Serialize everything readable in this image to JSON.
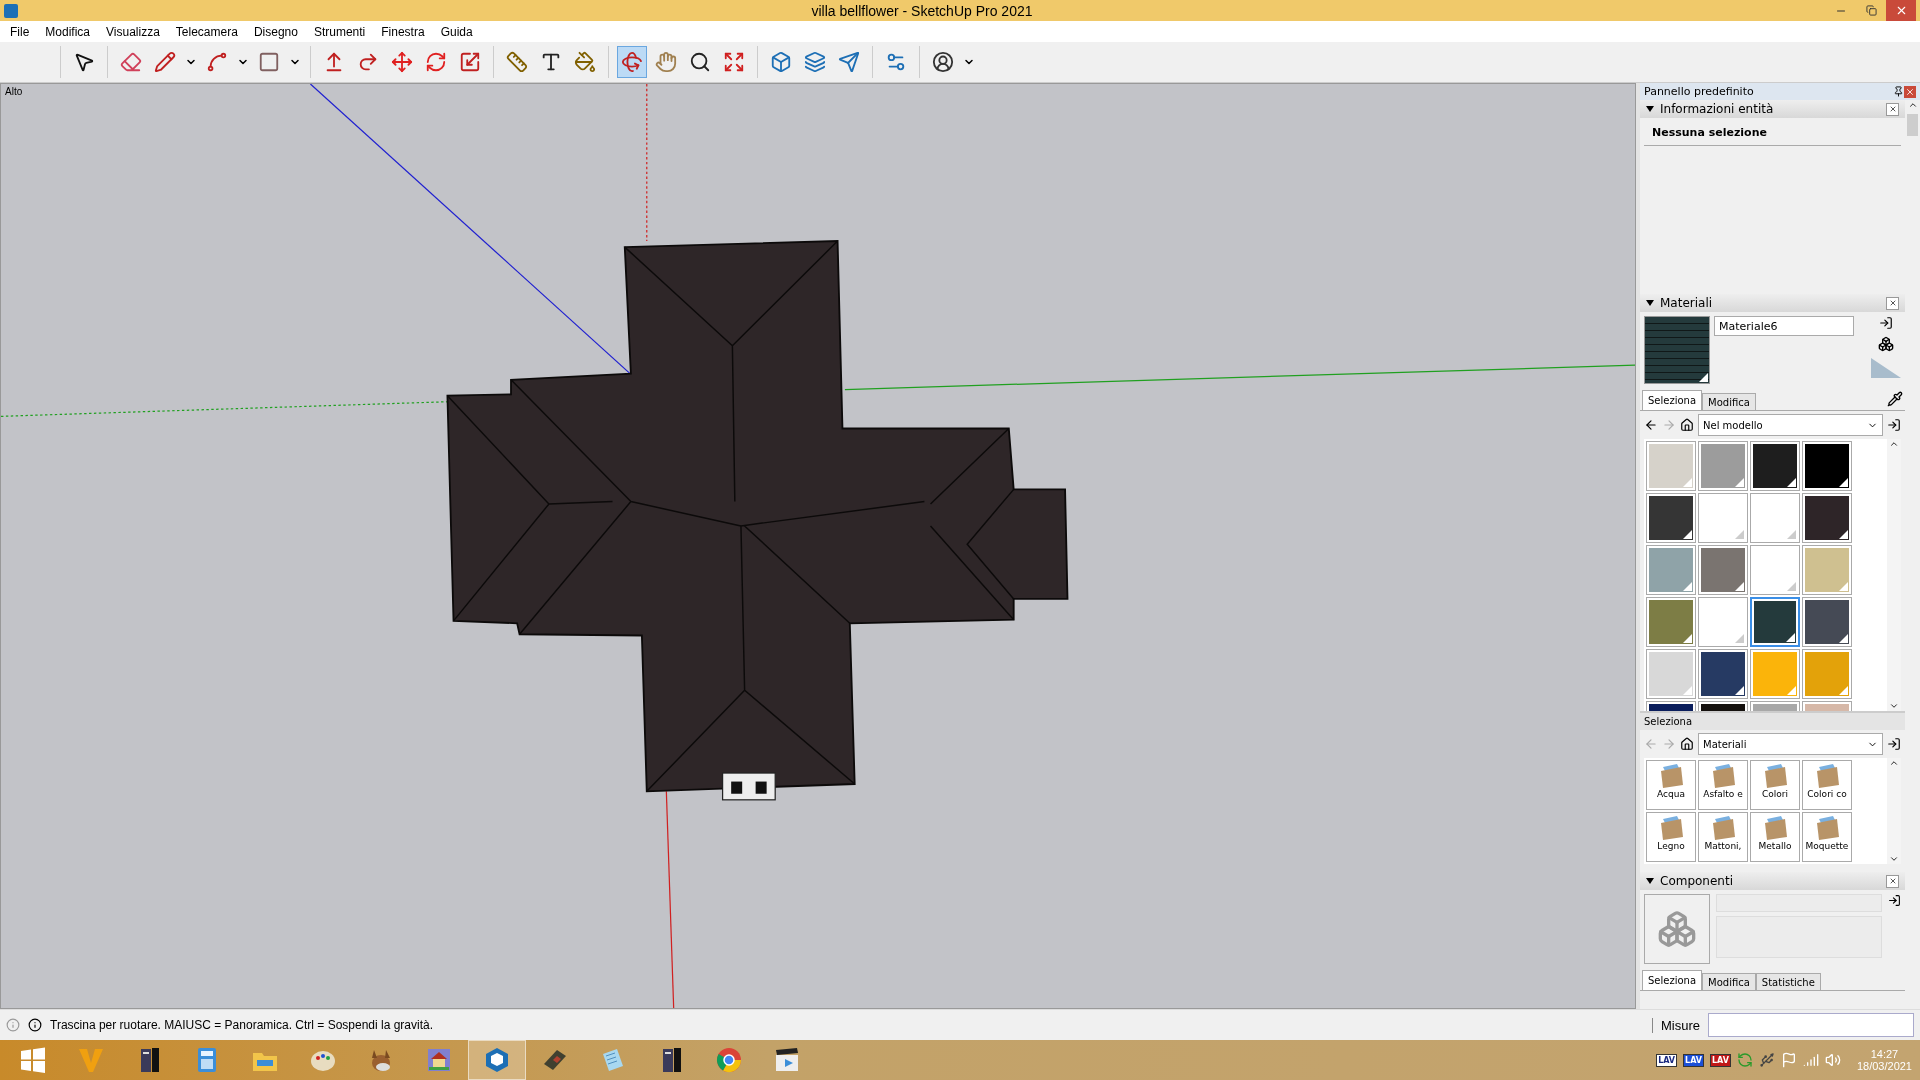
{
  "window": {
    "title": "villa bellflower - SketchUp Pro 2021"
  },
  "menu": [
    "File",
    "Modifica",
    "Visualizza",
    "Telecamera",
    "Disegno",
    "Strumenti",
    "Finestra",
    "Guida"
  ],
  "toolbar": [
    [
      {
        "kind": "select",
        "selected": false,
        "dropdown": false
      }
    ],
    [
      {
        "kind": "eraser",
        "selected": false,
        "dropdown": false
      },
      {
        "kind": "pencil",
        "selected": false,
        "dropdown": true
      },
      {
        "kind": "arc",
        "selected": false,
        "dropdown": true
      },
      {
        "kind": "rectangle",
        "selected": false,
        "dropdown": true
      }
    ],
    [
      {
        "kind": "pushpull",
        "selected": false,
        "dropdown": false
      },
      {
        "kind": "followme",
        "selected": false,
        "dropdown": false
      },
      {
        "kind": "move",
        "selected": false,
        "dropdown": false
      },
      {
        "kind": "rotate",
        "selected": false,
        "dropdown": false
      },
      {
        "kind": "scale",
        "selected": false,
        "dropdown": false
      }
    ],
    [
      {
        "kind": "tape",
        "selected": false,
        "dropdown": false
      },
      {
        "kind": "text",
        "selected": false,
        "dropdown": false
      },
      {
        "kind": "paint",
        "selected": false,
        "dropdown": false
      }
    ],
    [
      {
        "kind": "orbit",
        "selected": true,
        "dropdown": false
      },
      {
        "kind": "pan",
        "selected": false,
        "dropdown": false
      },
      {
        "kind": "zoom",
        "selected": false,
        "dropdown": false
      },
      {
        "kind": "extents",
        "selected": false,
        "dropdown": false
      }
    ],
    [
      {
        "kind": "warehouse",
        "selected": false,
        "dropdown": false
      },
      {
        "kind": "extensions",
        "selected": false,
        "dropdown": false
      },
      {
        "kind": "layout",
        "selected": false,
        "dropdown": false
      }
    ],
    [
      {
        "kind": "manager",
        "selected": false,
        "dropdown": false
      }
    ],
    [
      {
        "kind": "account",
        "selected": false,
        "dropdown": true
      }
    ]
  ],
  "viewport": {
    "view_label": "Alto"
  },
  "panel": {
    "title": "Pannello predefinito"
  },
  "entity_info": {
    "title": "Informazioni entità",
    "expanded": true,
    "selection": "Nessuna selezione"
  },
  "materials": {
    "title": "Materiali",
    "expanded": true,
    "name": "Materiale6",
    "tabs": [
      {
        "label": "Seleziona",
        "selected": true
      },
      {
        "label": "Modifica",
        "selected": false
      }
    ],
    "collection": "Nel modello",
    "swatches": [
      {
        "color": "#d6d2ca",
        "selected": false
      },
      {
        "color": "#9c9c9c",
        "selected": false
      },
      {
        "color": "#1e1e1e",
        "selected": false
      },
      {
        "color": "#000000",
        "selected": false
      },
      {
        "color": "#353535",
        "selected": false
      },
      {
        "color": "#ffffff",
        "selected": false
      },
      {
        "color": "#ffffff",
        "selected": false
      },
      {
        "color": "#2e2528",
        "selected": false
      },
      {
        "color": "#8fa3a8",
        "selected": false
      },
      {
        "color": "#7a7470",
        "selected": false
      },
      {
        "color": "#ffffff",
        "selected": false
      },
      {
        "color": "#cfc090",
        "selected": false
      },
      {
        "color": "#7d7d45",
        "selected": false
      },
      {
        "color": "#ffffff",
        "selected": false
      },
      {
        "color": "#243a3c",
        "selected": true
      },
      {
        "color": "#454a55",
        "selected": false
      },
      {
        "color": "#d8d8d8",
        "selected": false
      },
      {
        "color": "#263a63",
        "selected": false
      },
      {
        "color": "#fbb40a",
        "selected": false
      },
      {
        "color": "#e3a20a",
        "selected": false
      },
      {
        "color": "#0b1e5c",
        "selected": false
      },
      {
        "color": "#15110e",
        "selected": false
      },
      {
        "color": "#a8a8a8",
        "selected": false
      },
      {
        "color": "#d6b8a8",
        "selected": false
      }
    ],
    "browser_label": "Seleziona",
    "browser_collection": "Materiali",
    "folders": [
      "Acqua",
      "Asfalto e",
      "Colori",
      "Colori co",
      "Legno",
      "Mattoni,",
      "Metallo",
      "Moquette"
    ]
  },
  "components": {
    "title": "Componenti",
    "expanded": true,
    "tabs": [
      {
        "label": "Seleziona",
        "selected": true
      },
      {
        "label": "Modifica",
        "selected": false
      },
      {
        "label": "Statistiche",
        "selected": false
      }
    ]
  },
  "status_bar": {
    "hint": "Trascina per ruotare. MAIUSC = Panoramica. Ctrl = Sospendi la gravità.",
    "measure_label": "Misure"
  },
  "taskbar": {
    "apps": [
      {
        "kind": "start",
        "selected": false
      },
      {
        "kind": "v",
        "selected": false
      },
      {
        "kind": "tower",
        "selected": false
      },
      {
        "kind": "calculator",
        "selected": false
      },
      {
        "kind": "folder",
        "selected": false
      },
      {
        "kind": "palette",
        "selected": false
      },
      {
        "kind": "donkey",
        "selected": false
      },
      {
        "kind": "house",
        "selected": false
      },
      {
        "kind": "sketch",
        "selected": true
      },
      {
        "kind": "book",
        "selected": false
      },
      {
        "kind": "notepad",
        "selected": false
      },
      {
        "kind": "tower",
        "selected": false
      },
      {
        "kind": "browser",
        "selected": false
      },
      {
        "kind": "video",
        "selected": false
      }
    ],
    "tray": [
      {
        "kind": "badge",
        "label": "LAV",
        "color": "#ffffff"
      },
      {
        "kind": "badge",
        "label": "LAV",
        "color": "#1b4fd8"
      },
      {
        "kind": "badge",
        "label": "LAV",
        "color": "#c01818"
      },
      {
        "kind": "sync"
      },
      {
        "kind": "usb"
      },
      {
        "kind": "flag"
      },
      {
        "kind": "signal"
      },
      {
        "kind": "volume"
      }
    ],
    "time": "14:27",
    "date": "18/03/2021"
  }
}
